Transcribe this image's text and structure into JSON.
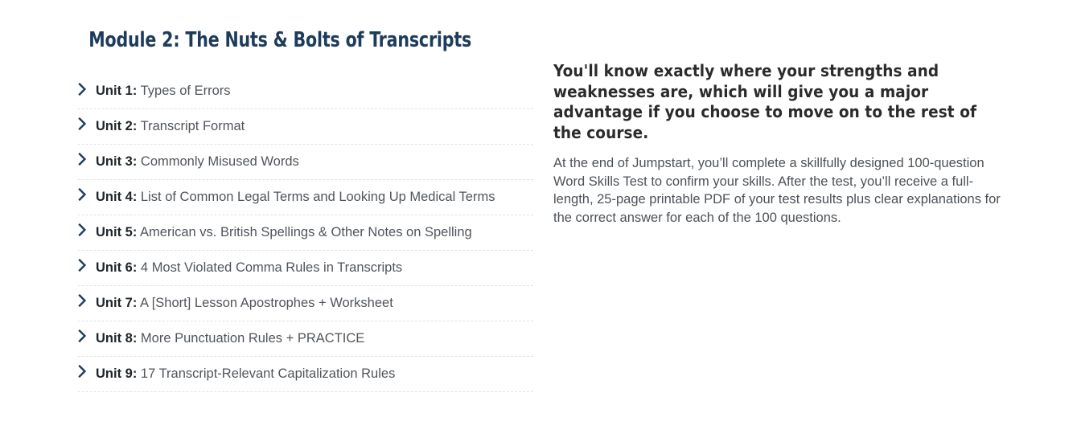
{
  "module": {
    "title": "Module 2: The Nuts & Bolts of Transcripts",
    "units": [
      {
        "label": "Unit 1:",
        "desc": " Types of Errors"
      },
      {
        "label": "Unit 2:",
        "desc": " Transcript Format"
      },
      {
        "label": "Unit 3:",
        "desc": " Commonly Misused Words"
      },
      {
        "label": "Unit 4:",
        "desc": " List of Common Legal Terms and Looking Up Medical Terms"
      },
      {
        "label": "Unit 5:",
        "desc": " American vs. British Spellings & Other Notes on Spelling"
      },
      {
        "label": "Unit 6:",
        "desc": " 4 Most Violated Comma Rules in Transcripts"
      },
      {
        "label": "Unit 7:",
        "desc": " A [Short] Lesson Apostrophes + Worksheet"
      },
      {
        "label": "Unit 8:",
        "desc": " More Punctuation Rules + PRACTICE"
      },
      {
        "label": "Unit 9:",
        "desc": " 17 Transcript-Relevant Capitalization Rules"
      }
    ],
    "chevron_icon": "chevron-right-icon"
  },
  "promo": {
    "heading": "You'll know exactly where your strengths and weaknesses are, which will give you a major advantage if you choose to move on to the rest of the course.",
    "body": "At the end of Jumpstart, you’ll complete a skillfully designed 100-question Word Skills Test to confirm your skills. After the test, you’ll receive a full-length, 25-page printable PDF of your test results plus clear explanations for the correct answer for each of the 100 questions."
  },
  "colors": {
    "title_navy": "#1d3c5c",
    "unit_label": "#1f2529",
    "unit_desc": "#50555b",
    "heading_dark": "#2b2b2b",
    "body_gray": "#4c5157",
    "divider": "#e2e2e2",
    "background": "#ffffff"
  }
}
